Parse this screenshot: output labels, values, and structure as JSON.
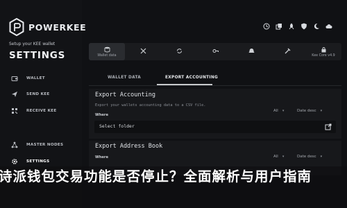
{
  "app": {
    "brand": "POWERKEE",
    "tagline": "Setup your KEE wallet",
    "page_title": "SETTINGS"
  },
  "sidebar": {
    "items": [
      {
        "label": "WALLET",
        "icon": "wallet-icon",
        "active": false
      },
      {
        "label": "SEND KEE",
        "icon": "send-icon",
        "active": false
      },
      {
        "label": "RECEIVE KEE",
        "icon": "receive-icon",
        "active": false
      },
      {
        "label": "MASTER NODES",
        "icon": "nodes-icon",
        "active": false
      },
      {
        "label": "SETTINGS",
        "icon": "gear-icon",
        "active": true
      }
    ]
  },
  "top_icons": [
    "clock-icon",
    "copy-icon",
    "rocket-icon",
    "shield-icon",
    "moon-icon",
    "cloud-icon"
  ],
  "tabs": [
    {
      "label": "Wallet data",
      "icon": "database-icon",
      "active": true
    },
    {
      "label": "",
      "icon": "cross-arrows-icon",
      "active": false
    },
    {
      "label": "",
      "icon": "sync-icon",
      "active": false
    },
    {
      "label": "",
      "icon": "key-icon",
      "active": false
    },
    {
      "label": "",
      "icon": "bell-icon",
      "active": false
    },
    {
      "label": "",
      "icon": "tools-icon",
      "active": false
    },
    {
      "label": "Kee Core v4.9",
      "icon": "lock-icon",
      "active": false
    }
  ],
  "subtabs": {
    "wallet_data": "WALLET DATA",
    "export_accounting": "EXPORT ACCOUNTING"
  },
  "export_accounting": {
    "title": "Export Accounting",
    "description": "Export your wallets accounting data to a CSV file.",
    "where_label": "Where",
    "filter_all": "All",
    "filter_sort": "Date desc",
    "folder_placeholder": "Select folder"
  },
  "export_address_book": {
    "title": "Export Address Book",
    "where_label": "Where",
    "filter_all": "All",
    "filter_sort": "Date desc"
  },
  "overlay": {
    "text": "诗派钱包交易功能是否停止？全面解析与用户指南"
  },
  "colors": {
    "background": "#0e0f11",
    "sidebar": "#121316",
    "panel": "#17181b",
    "text": "#d8dbe0"
  }
}
